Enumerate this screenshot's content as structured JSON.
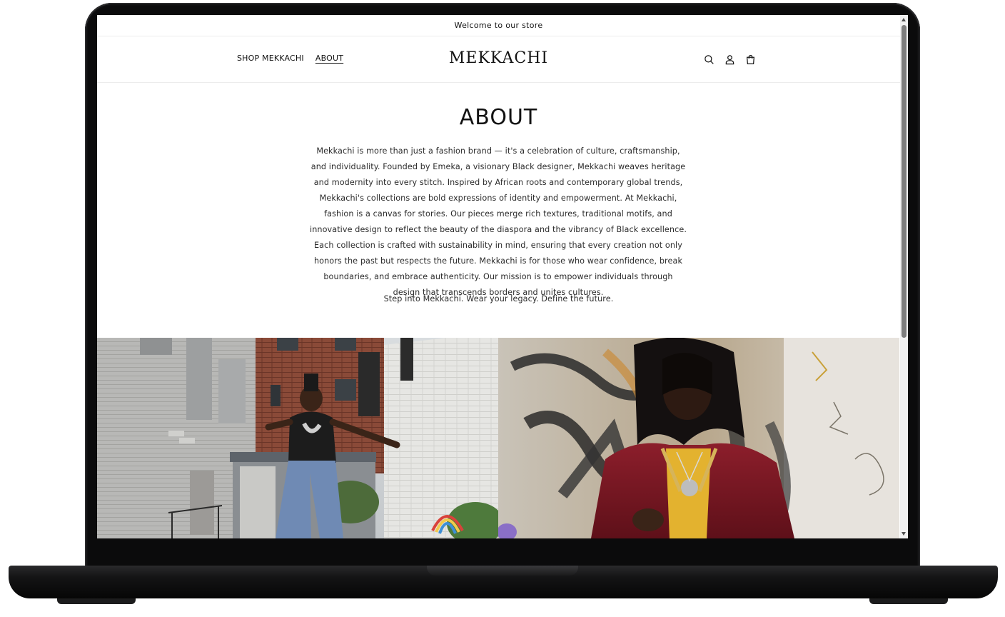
{
  "announcement": {
    "text": "Welcome to our store"
  },
  "header": {
    "nav": [
      {
        "label": "SHOP MEKKACHI",
        "active": false
      },
      {
        "label": "ABOUT",
        "active": true
      }
    ],
    "logo": "MEKKACHI",
    "icons": [
      "search-icon",
      "account-icon",
      "cart-icon"
    ]
  },
  "about": {
    "title": "ABOUT",
    "body": "Mekkachi is more than just a fashion brand — it's a celebration of culture, craftsmanship, and individuality. Founded by Emeka, a visionary Black designer, Mekkachi weaves heritage and modernity into every stitch. Inspired by African roots and contemporary global trends, Mekkachi's collections are bold expressions of identity and empowerment. At Mekkachi, fashion is a canvas for stories. Our pieces merge rich textures, traditional motifs, and innovative design to reflect the beauty of the diaspora and the vibrancy of Black excellence. Each collection is crafted with sustainability in mind, ensuring that every creation not only honors the past but respects the future. Mekkachi is for those who wear confidence, break boundaries, and embrace authenticity. Our mission is to empower individuals through design that transcends borders and unites cultures.",
    "tagline": "Step into Mekkachi. Wear your legacy. Define the future."
  },
  "colors": {
    "text": "#121212",
    "body_text": "#2b2b2b",
    "background": "#ffffff",
    "divider": "#ececec"
  }
}
